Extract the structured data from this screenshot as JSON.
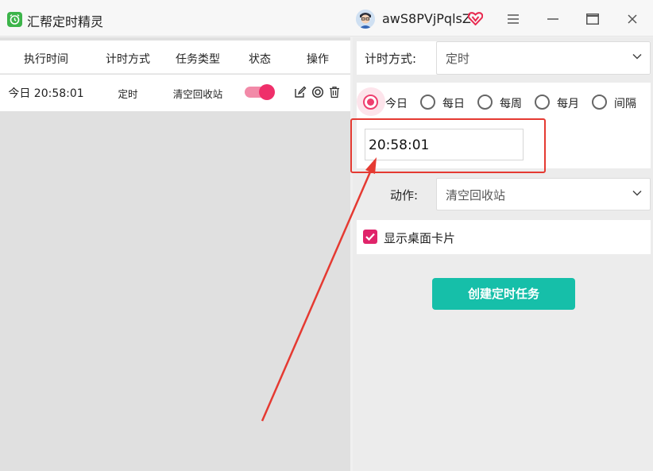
{
  "app": {
    "title": "汇帮定时精灵",
    "username": "awS8PVjPqlsZ"
  },
  "colors": {
    "accent_pink": "#ee3f6f",
    "button_teal": "#16bfa9",
    "annotation_red": "#e53a32"
  },
  "icons": {
    "app_logo": "alarm-clock-icon",
    "vip": "vip-heart-diamond-icon",
    "menu": "hamburger-menu-icon",
    "minimize": "minimize-icon",
    "maximize": "maximize-icon",
    "close": "close-icon",
    "edit": "edit-icon",
    "view": "target-icon",
    "delete": "trash-icon",
    "chevron": "chevron-down-icon",
    "check": "checkmark-icon"
  },
  "table": {
    "headers": [
      "执行时间",
      "计时方式",
      "任务类型",
      "状态",
      "操作"
    ],
    "rows": [
      {
        "exec_time": "今日 20:58:01",
        "timing_mode": "定时",
        "task_type": "清空回收站",
        "enabled": true
      }
    ]
  },
  "form": {
    "timing_label": "计时方式:",
    "timing_value": "定时",
    "day_options": [
      "今日",
      "每日",
      "每周",
      "每月",
      "间隔"
    ],
    "selected_day": "今日",
    "time_value": "20:58:01",
    "action_label": "动作:",
    "action_value": "清空回收站",
    "show_card_label": "显示桌面卡片",
    "show_card_checked": true,
    "create_button": "创建定时任务"
  }
}
